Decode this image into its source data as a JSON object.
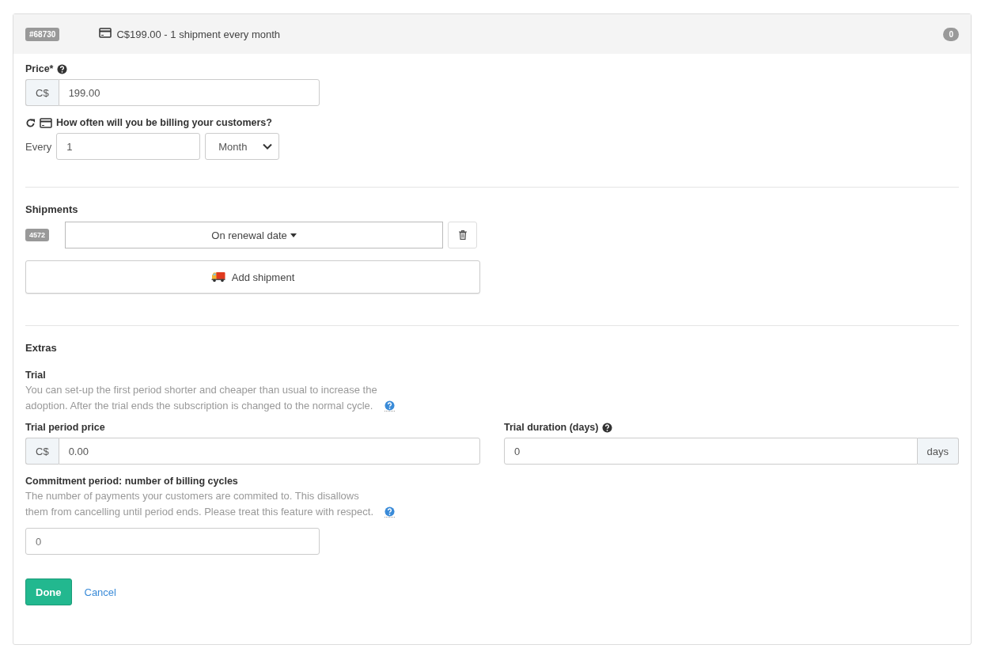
{
  "header": {
    "badge": "#68730",
    "summary": "C$199.00 - 1 shipment every month",
    "count": "0"
  },
  "price": {
    "label": "Price*",
    "currency": "C$",
    "value": "199.00"
  },
  "billing": {
    "label": "How often will you be billing your customers?",
    "prefix": "Every",
    "interval": "1",
    "period": "Month"
  },
  "shipments": {
    "title": "Shipments",
    "items": [
      {
        "badge": "4572",
        "schedule": "On renewal date"
      }
    ],
    "add_label": "Add shipment"
  },
  "extras": {
    "title": "Extras",
    "trial_title": "Trial",
    "trial_help": "You can set-up the first period shorter and cheaper than usual to increase the adoption. After the trial ends the subscription is changed to the normal cycle.",
    "trial_price": {
      "label": "Trial period price",
      "currency": "C$",
      "value": "0.00"
    },
    "trial_duration": {
      "label": "Trial duration (days)",
      "value": "0",
      "suffix": "days"
    },
    "commitment": {
      "label": "Commitment period: number of billing cycles",
      "help": "The number of payments your customers are commited to. This disallows them from cancelling until period ends. Please treat this feature with respect.",
      "placeholder": "0"
    }
  },
  "actions": {
    "done": "Done",
    "cancel": "Cancel"
  }
}
